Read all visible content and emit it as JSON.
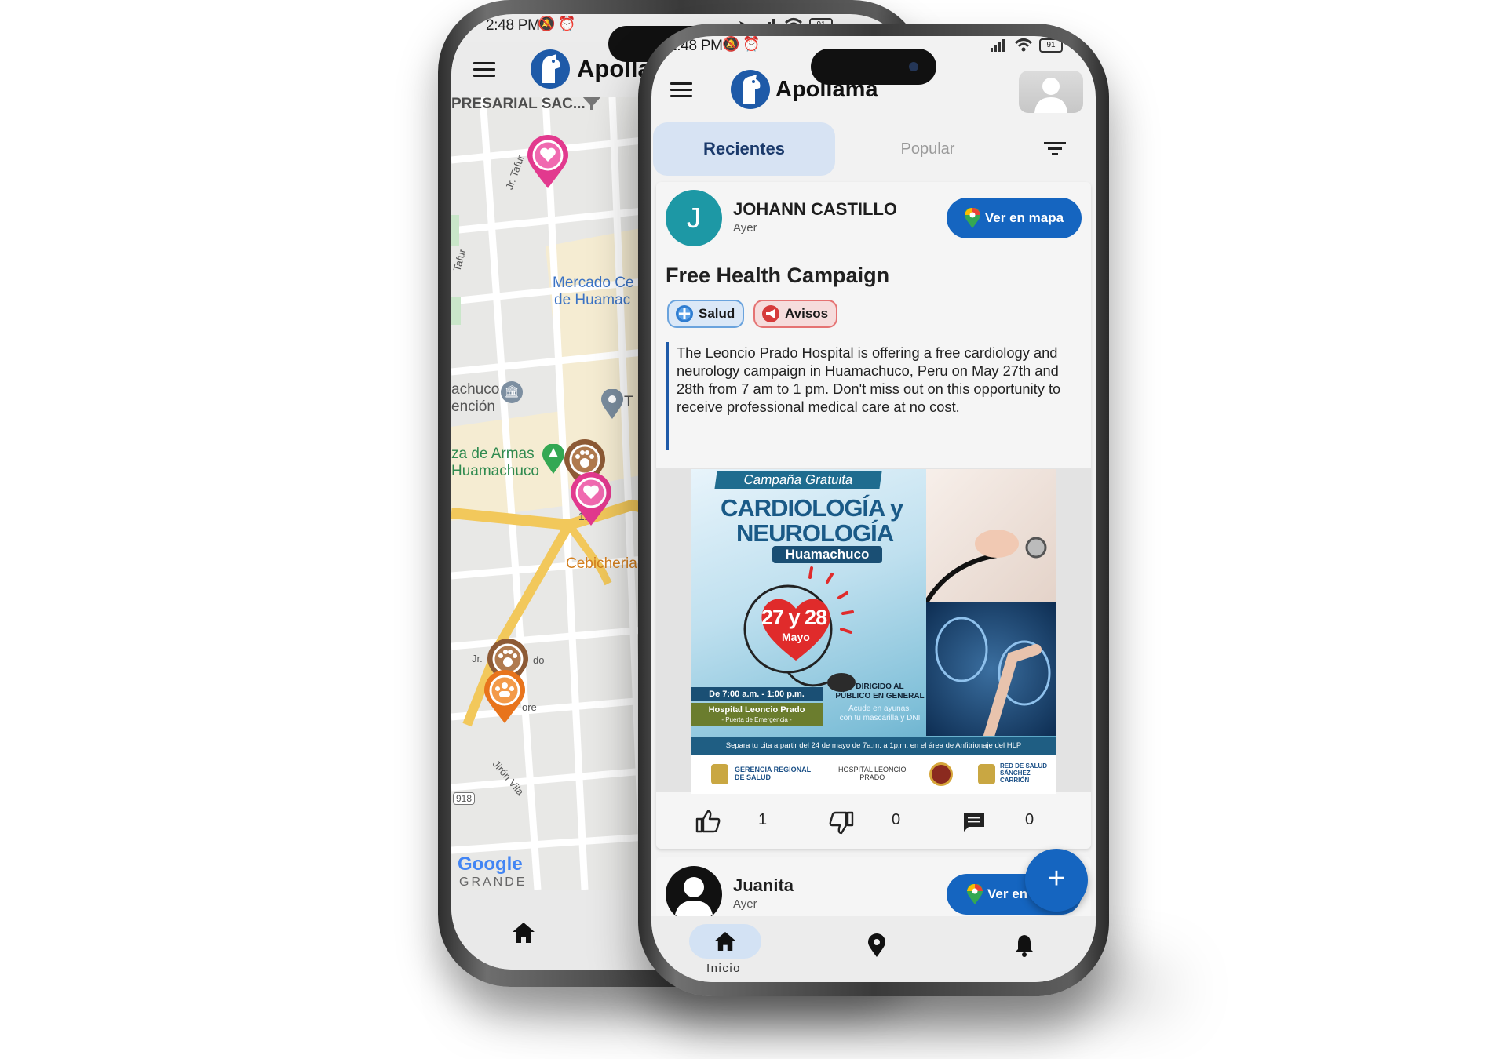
{
  "back_phone": {
    "status": {
      "time": "2:48 PM",
      "battery": "91"
    },
    "app_name": "Apolla",
    "map": {
      "top_label": "PRESARIAL SAC...",
      "labels": {
        "street_tafur": "Jr. Tafur",
        "street_tafur_left": "Tafur",
        "market_line1": "Mercado Ce",
        "market_line2": "de Huamac",
        "huamachuco_line1": "achuco",
        "huamachuco_line2": "ención",
        "plaza_line1": "za de Armas",
        "plaza_line2": "Huamachuco",
        "number_127": "127",
        "cebicheria": "Cebicheria",
        "jr": "Jr.",
        "do": "do",
        "ore": "ore",
        "jiron_vila": "Jirón Vila",
        "route_918": "918",
        "grande": "GRANDE",
        "t": "T"
      },
      "google_logo": "Google"
    }
  },
  "front_phone": {
    "status": {
      "time": "2:48 PM",
      "battery": "91"
    },
    "app_name": "Apollama",
    "tabs": {
      "recent": "Recientes",
      "popular": "Popular"
    },
    "post1": {
      "avatar_letter": "J",
      "author": "JOHANN CASTILLO",
      "time": "Ayer",
      "map_button": "Ver en mapa",
      "title": "Free Health Campaign",
      "tags": [
        {
          "label": "Salud"
        },
        {
          "label": "Avisos"
        }
      ],
      "body": "The Leoncio Prado Hospital is offering a free cardiology and neurology campaign in Huamachuco, Peru on May 27th and 28th from 7 am to 1 pm. Don't miss out on this opportunity to receive professional medical care at no cost.",
      "poster": {
        "banner": "Campaña Gratuita",
        "title_line1": "CARDIOLOGÍA y",
        "title_line2": "NEUROLOGÍA",
        "place": "Huamachuco",
        "dates": "27 y 28",
        "month": "Mayo",
        "hours": "De 7:00 a.m. - 1:00 p.m.",
        "hospital": "Hospital Leoncio Prado",
        "hospital_sub": "- Puerta de Emergencia -",
        "audience_line1": "DIRIGIDO AL",
        "audience_line2": "PÚBLICO EN GENERAL",
        "fasting_line1": "Acude en ayunas,",
        "fasting_line2": "con tu mascarilla y DNI",
        "footer": "Separa tu cita a partir del 24 de mayo de 7a.m. a 1p.m. en el área de Anfitrionaje del HLP",
        "logo1_line1": "GERENCIA REGIONAL",
        "logo1_line2": "DE SALUD",
        "logo2_line1": "HOSPITAL LEONCIO",
        "logo2_line2": "PRADO",
        "logo3_line1": "RED DE SALUD",
        "logo3_line2": "SÁNCHEZ",
        "logo3_line3": "CARRIÓN"
      },
      "likes": "1",
      "dislikes": "0",
      "comments": "0"
    },
    "post2": {
      "author": "Juanita",
      "time": "Ayer",
      "map_button": "Ver en ."
    },
    "fab": "+",
    "nav": {
      "home": "Inicio"
    }
  }
}
